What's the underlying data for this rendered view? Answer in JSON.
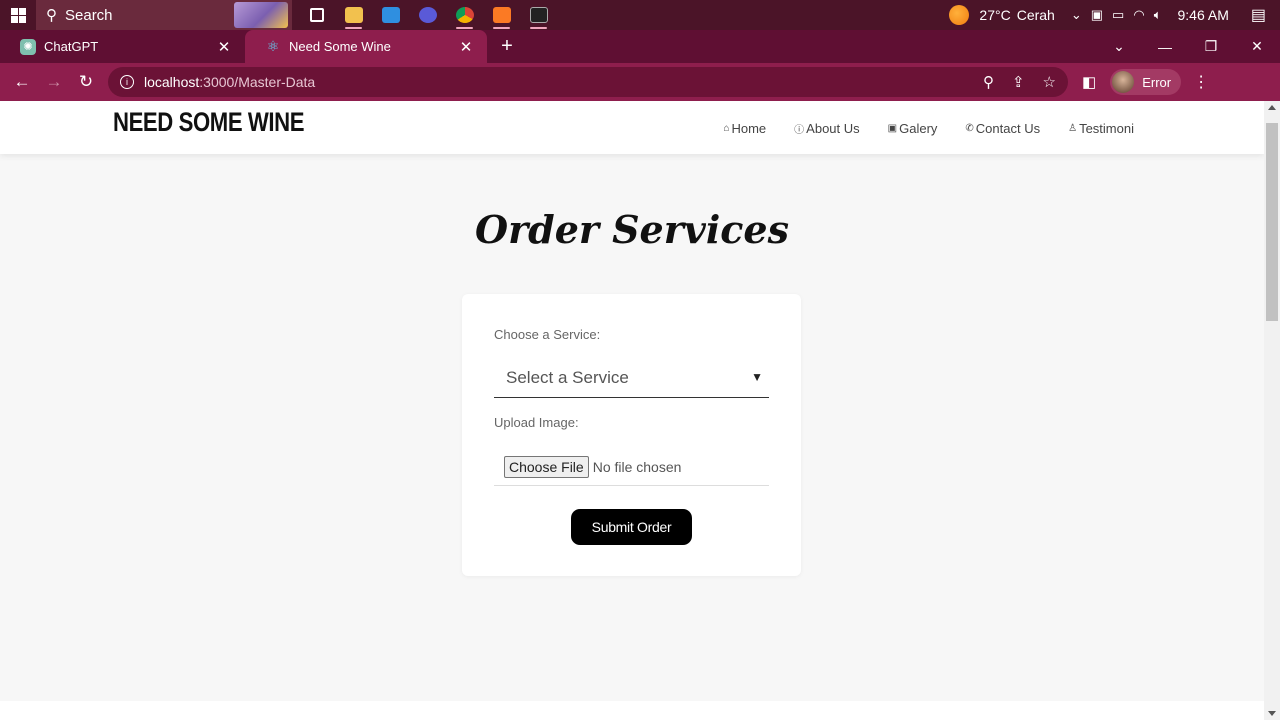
{
  "taskbar": {
    "search_label": "Search",
    "weather_temp": "27°C",
    "weather_desc": "Cerah",
    "time": "9:46 AM",
    "apps": [
      "task-view",
      "file-explorer",
      "mail",
      "media",
      "chrome",
      "xampp",
      "terminal"
    ]
  },
  "browser": {
    "tabs": [
      {
        "title": "ChatGPT",
        "active": false
      },
      {
        "title": "Need Some Wine",
        "active": true
      }
    ],
    "url_host": "localhost",
    "url_rest": ":3000/Master-Data",
    "profile_label": "Error"
  },
  "site": {
    "brand": "NEED SOME WINE",
    "nav": [
      {
        "label": "Home",
        "icon": "home-icon",
        "glyph": "⌂"
      },
      {
        "label": "About Us",
        "icon": "info-icon",
        "glyph": "ⓘ"
      },
      {
        "label": "Galery",
        "icon": "image-icon",
        "glyph": "▣"
      },
      {
        "label": "Contact Us",
        "icon": "phone-icon",
        "glyph": "✆"
      },
      {
        "label": "Testimoni",
        "icon": "user-icon",
        "glyph": "♙"
      }
    ]
  },
  "main": {
    "title": "Order Services",
    "form": {
      "service_label": "Choose a Service:",
      "service_selected": "Select a Service",
      "upload_label": "Upload Image:",
      "file_button": "Choose File",
      "file_status": "No file chosen",
      "submit_label": "Submit Order"
    }
  },
  "colors": {
    "taskbar": "#4b1428",
    "tabstrip": "#5f0f33",
    "toolbar": "#8e1e4d",
    "page_bg": "#f7f7f7",
    "button": "#000000"
  }
}
